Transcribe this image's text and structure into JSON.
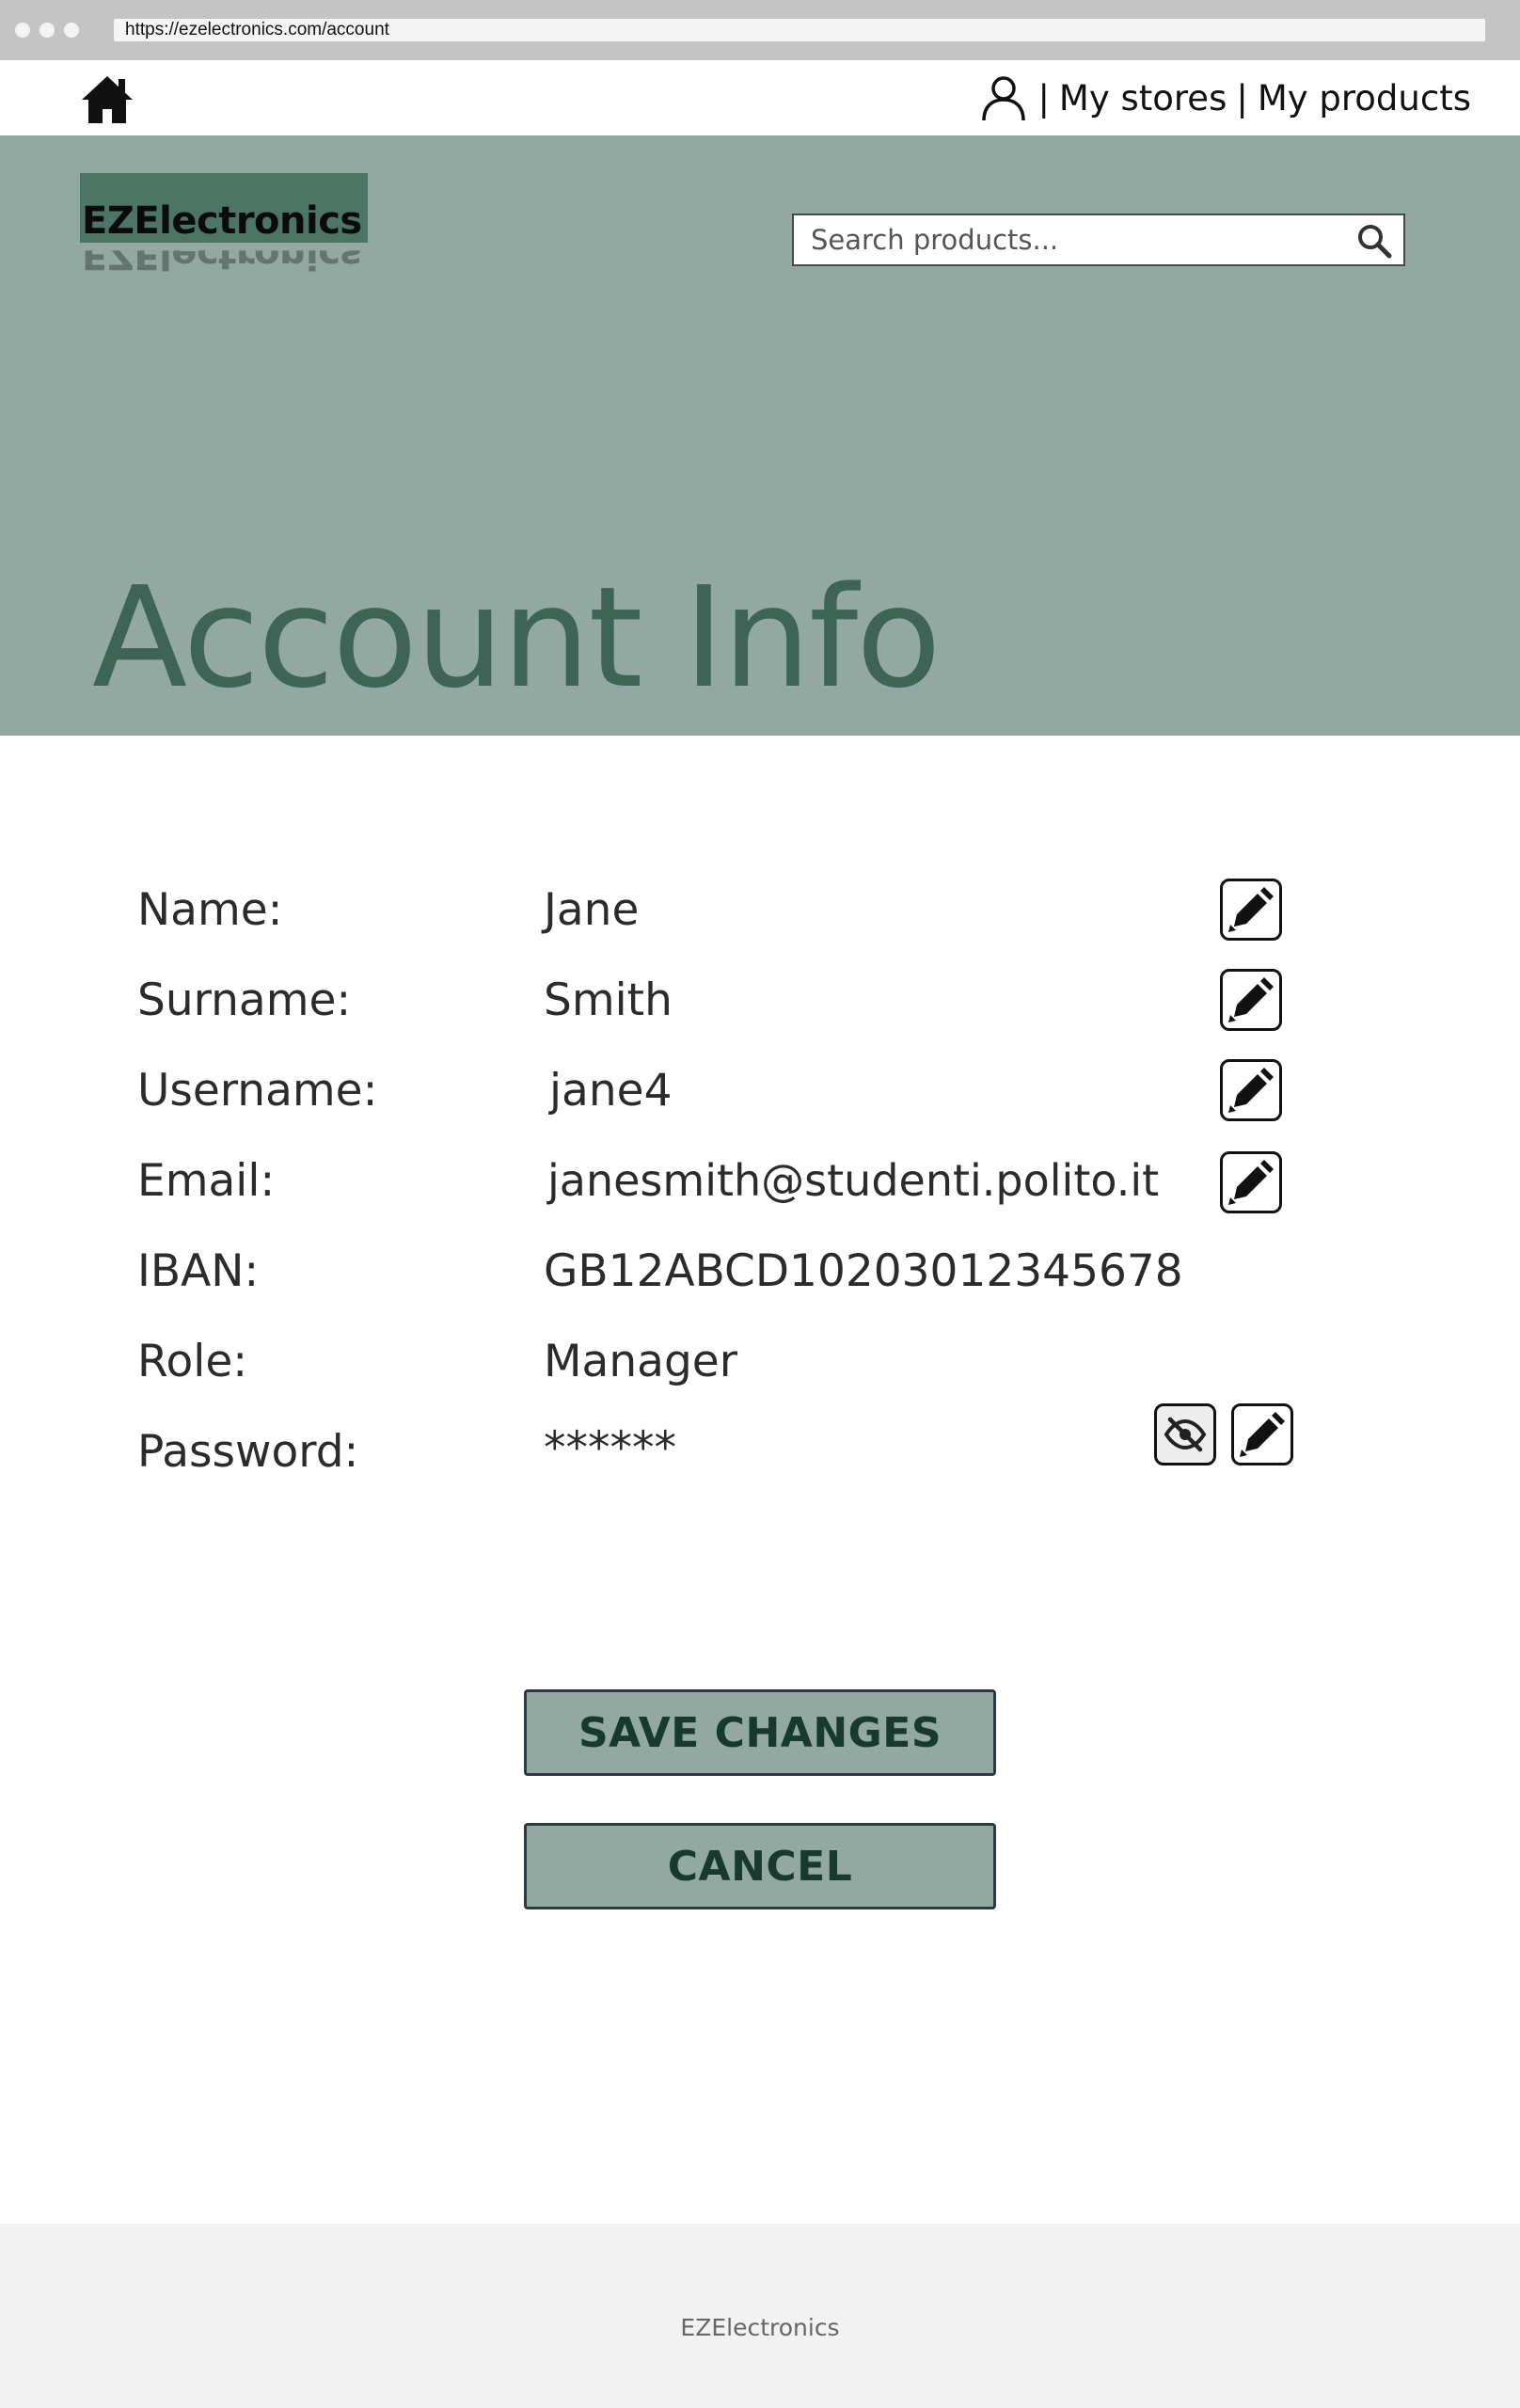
{
  "browser": {
    "url": "https://ezelectronics.com/account"
  },
  "nav": {
    "separator": "|",
    "my_stores": "My stores",
    "my_products": "My products"
  },
  "header": {
    "logo": "EZElectronics",
    "search_placeholder": "Search products..."
  },
  "page": {
    "title": "Account Info"
  },
  "account": {
    "rows": [
      {
        "label": "Name:",
        "value": "Jane",
        "editable": true
      },
      {
        "label": "Surname:",
        "value": "Smith",
        "editable": true
      },
      {
        "label": "Username:",
        "value": "jane4",
        "editable": true
      },
      {
        "label": "Email:",
        "value": "janesmith@studenti.polito.it",
        "editable": true
      },
      {
        "label": "IBAN:",
        "value": "GB12ABCD10203012345678",
        "editable": false
      },
      {
        "label": "Role:",
        "value": "Manager",
        "editable": false
      },
      {
        "label": "Password:",
        "value": "******",
        "editable": true
      }
    ]
  },
  "actions": {
    "save": "SAVE CHANGES",
    "cancel": "CANCEL"
  },
  "footer": {
    "text": "EZElectronics"
  },
  "icons": {
    "home": "home-icon",
    "user": "user-icon",
    "search": "search-icon",
    "edit": "pencil-icon",
    "visibility": "eye-slash-icon"
  },
  "colors": {
    "hero_bg": "#92a9a1",
    "logo_bg": "#4d7566",
    "title": "#3e6456",
    "button_text": "#173a2d"
  }
}
